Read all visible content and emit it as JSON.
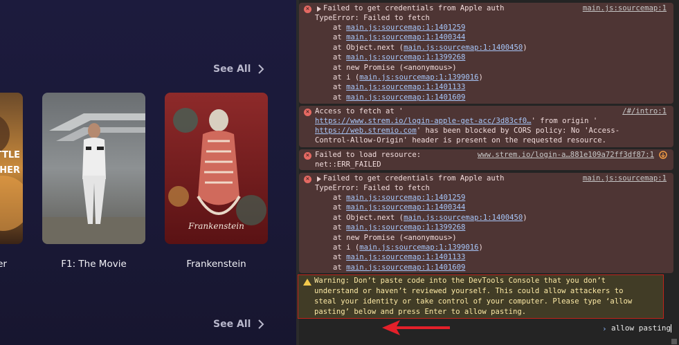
{
  "app": {
    "see_all_top": "See All",
    "see_all_bottom": "See All",
    "posters": [
      {
        "title": "er"
      },
      {
        "title": "F1: The Movie"
      },
      {
        "title": "Frankenstein"
      }
    ],
    "poster_art": {
      "left_poster_text": "TTLE\nHER",
      "frankenstein_script": "Frankenstein"
    }
  },
  "console": {
    "messages": [
      {
        "type": "error",
        "first_line": "Failed to get credentials from Apple auth",
        "source": "main.js:sourcemap:1",
        "second_line": "TypeError: Failed to fetch",
        "stack": [
          {
            "prefix": "at ",
            "link": "main.js:sourcemap:1:1401259",
            "suffix": ""
          },
          {
            "prefix": "at ",
            "link": "main.js:sourcemap:1:1400344",
            "suffix": ""
          },
          {
            "prefix": "at Object.next (",
            "link": "main.js:sourcemap:1:1400450",
            "suffix": ")"
          },
          {
            "prefix": "at ",
            "link": "main.js:sourcemap:1:1399268",
            "suffix": ""
          },
          {
            "prefix": "at new Promise (<anonymous>)",
            "link": "",
            "suffix": ""
          },
          {
            "prefix": "at i (",
            "link": "main.js:sourcemap:1:1399016",
            "suffix": ")"
          },
          {
            "prefix": "at ",
            "link": "main.js:sourcemap:1:1401133",
            "suffix": ""
          },
          {
            "prefix": "at ",
            "link": "main.js:sourcemap:1:1401609",
            "suffix": ""
          }
        ]
      },
      {
        "type": "error",
        "line1": "Access to fetch at '",
        "source": "/#/intro:1",
        "url1": "https://www.strem.io/login-apple-get-acc/3d83cf0…",
        "line2_suffix": "' from origin '",
        "url2": "https://web.stremio.com",
        "line3_suffix": "' has been blocked by CORS policy: No 'Access-",
        "line4": "Control-Allow-Origin' header is present on the requested resource."
      },
      {
        "type": "error",
        "line1": "Failed to load resource:",
        "source": "www.strem.io/login-a…881e109a72ff3df87:1",
        "line2": "net::ERR_FAILED"
      },
      {
        "type": "error",
        "first_line": "Failed to get credentials from Apple auth",
        "source": "main.js:sourcemap:1",
        "second_line": "TypeError: Failed to fetch",
        "stack": [
          {
            "prefix": "at ",
            "link": "main.js:sourcemap:1:1401259",
            "suffix": ""
          },
          {
            "prefix": "at ",
            "link": "main.js:sourcemap:1:1400344",
            "suffix": ""
          },
          {
            "prefix": "at Object.next (",
            "link": "main.js:sourcemap:1:1400450",
            "suffix": ")"
          },
          {
            "prefix": "at ",
            "link": "main.js:sourcemap:1:1399268",
            "suffix": ""
          },
          {
            "prefix": "at new Promise (<anonymous>)",
            "link": "",
            "suffix": ""
          },
          {
            "prefix": "at i (",
            "link": "main.js:sourcemap:1:1399016",
            "suffix": ")"
          },
          {
            "prefix": "at ",
            "link": "main.js:sourcemap:1:1401133",
            "suffix": ""
          },
          {
            "prefix": "at ",
            "link": "main.js:sourcemap:1:1401609",
            "suffix": ""
          }
        ]
      }
    ],
    "warning": {
      "lines": [
        "Warning: Don’t paste code into the DevTools Console that you don’t",
        "understand or haven’t reviewed yourself. This could allow attackers to",
        "steal your identity or take control of your computer. Please type ‘allow",
        "pasting’ below and press Enter to allow pasting."
      ]
    },
    "prompt_symbol": "›",
    "input_value": "allow pasting"
  },
  "colors": {
    "error_bg": "#4e3534",
    "warning_bg": "#413c26",
    "warning_border": "#c2231b",
    "link": "#a8c7fa",
    "arrow": "#e4202a"
  }
}
